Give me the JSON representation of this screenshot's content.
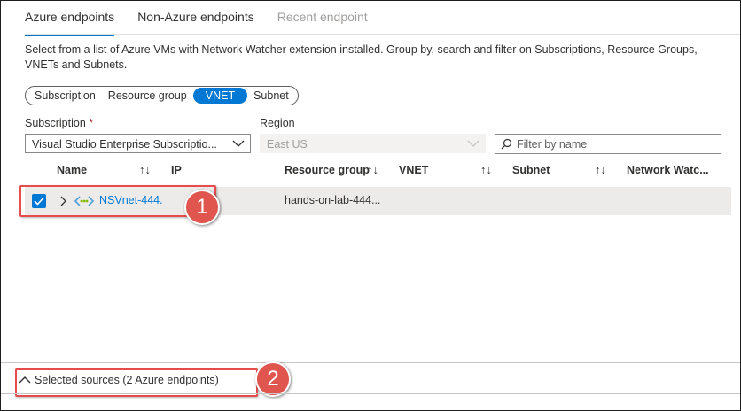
{
  "tabs": [
    {
      "label": "Azure endpoints",
      "state": "active"
    },
    {
      "label": "Non-Azure endpoints",
      "state": "normal"
    },
    {
      "label": "Recent endpoint",
      "state": "disabled"
    }
  ],
  "description": "Select from a list of Azure VMs with Network Watcher extension installed. Group by, search and filter on Subscriptions, Resource Groups, VNETs and Subnets.",
  "group_by": {
    "options": [
      "Subscription",
      "Resource group",
      "VNET",
      "Subnet"
    ],
    "selected": "VNET"
  },
  "subscription": {
    "label": "Subscription",
    "required_mark": "*",
    "value": "Visual Studio Enterprise Subscriptio..."
  },
  "region": {
    "label": "Region",
    "value": "East US"
  },
  "filter": {
    "placeholder": "Filter by name",
    "value": ""
  },
  "columns": [
    "Name",
    "IP",
    "Resource group",
    "VNET",
    "Subnet",
    "Network Watc..."
  ],
  "rows": [
    {
      "name": "NSVnet-444.",
      "ip": "",
      "resource_group": "hands-on-lab-444...",
      "vnet": "",
      "subnet": "",
      "network_watcher": "",
      "checked": true
    }
  ],
  "annotations": [
    "1",
    "2"
  ],
  "footer": {
    "selected_sources": "Selected sources (2 Azure endpoints)"
  },
  "colors": {
    "accent": "#0078d4",
    "callout": "#e0554d"
  }
}
